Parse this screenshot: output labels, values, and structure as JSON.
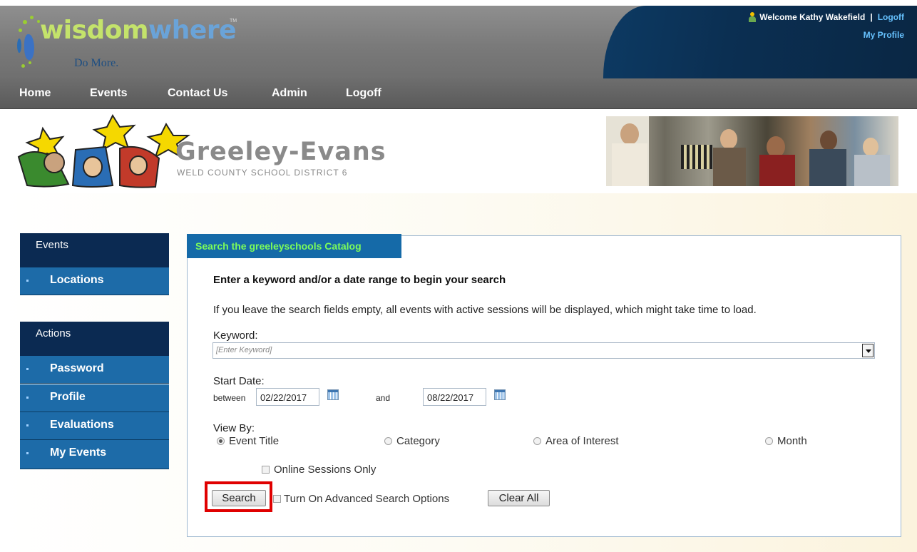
{
  "header": {
    "logo": {
      "word_part1": "wisdom",
      "word_part2": "where",
      "tm": "TM",
      "tagline": "Do More."
    },
    "welcome_text": "Welcome Kathy Wakefield",
    "separator": "|",
    "logoff_link": "Logoff",
    "my_profile_link": "My Profile",
    "user_icon": "user-icon"
  },
  "nav": {
    "items": [
      {
        "label": "Home"
      },
      {
        "label": "Events"
      },
      {
        "label": "Contact Us"
      },
      {
        "label": "Admin"
      },
      {
        "label": "Logoff"
      }
    ]
  },
  "banner": {
    "district_name": "Greeley-Evans",
    "district_sub": "WELD COUNTY SCHOOL DISTRICT 6"
  },
  "sidebar": {
    "events_header": "Events",
    "events_items": [
      {
        "label": "Locations"
      }
    ],
    "actions_header": "Actions",
    "actions_items": [
      {
        "label": "Password"
      },
      {
        "label": "Profile"
      },
      {
        "label": "Evaluations"
      },
      {
        "label": "My Events"
      }
    ]
  },
  "search": {
    "tab_title": "Search the greeleyschools Catalog",
    "heading": "Enter a keyword and/or a date range to begin your search",
    "help_text": "If you leave the search fields empty, all events with active sessions will be displayed, which might take time to load.",
    "keyword_label": "Keyword:",
    "keyword_placeholder": "[Enter Keyword]",
    "start_date_label": "Start Date:",
    "between_label": "between",
    "start_date_value": "02/22/2017",
    "and_label": "and",
    "end_date_value": "08/22/2017",
    "view_by_label": "View By:",
    "view_by_options": [
      {
        "label": "Event Title",
        "selected": true
      },
      {
        "label": "Category",
        "selected": false
      },
      {
        "label": "Area of Interest",
        "selected": false
      },
      {
        "label": "Month",
        "selected": false
      }
    ],
    "online_only_label": "Online Sessions Only",
    "search_button": "Search",
    "advanced_label": "Turn On Advanced Search Options",
    "clear_button": "Clear All"
  },
  "colors": {
    "nav_bg": "#5a5a5a",
    "sidebar_header": "#0b2a52",
    "sidebar_item": "#1d6ba8",
    "tab_bg": "#156aa8",
    "tab_text": "#7cfc5a",
    "highlight": "#e00000",
    "link": "#66c2ff"
  }
}
